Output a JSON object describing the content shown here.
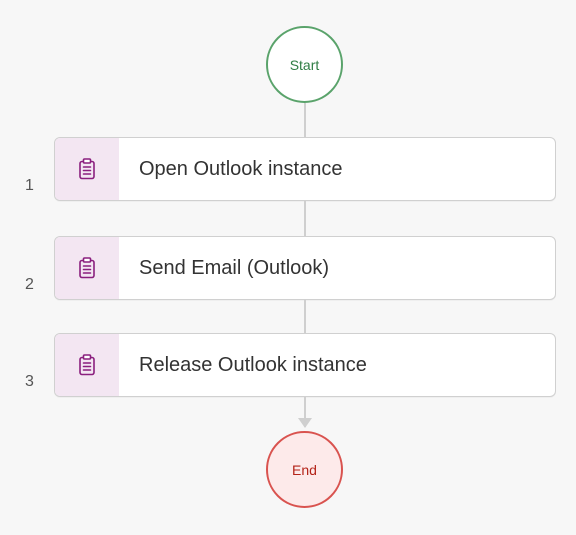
{
  "flow": {
    "start_label": "Start",
    "end_label": "End",
    "steps": [
      {
        "number": "1",
        "label": "Open Outlook instance",
        "icon": "clipboard-icon"
      },
      {
        "number": "2",
        "label": "Send Email (Outlook)",
        "icon": "clipboard-icon"
      },
      {
        "number": "3",
        "label": "Release Outlook instance",
        "icon": "clipboard-icon"
      }
    ]
  },
  "colors": {
    "start_border": "#5aa36b",
    "end_border": "#d9534f",
    "end_fill": "#fdeaea",
    "step_icon_bg": "#f3e6f2",
    "step_icon": "#8a1f7e",
    "connector": "#cfcfcf"
  }
}
